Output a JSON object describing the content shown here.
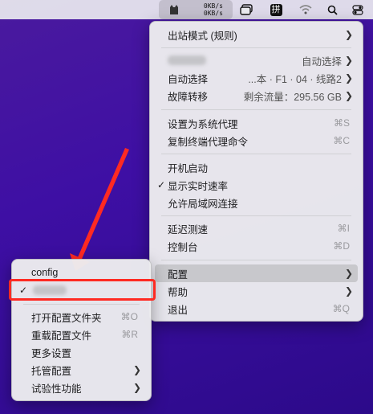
{
  "menubar": {
    "upload_speed": "0KB/s",
    "download_speed": "0KB/s",
    "input_method_label": "拼"
  },
  "main_menu": {
    "outbound_mode": "出站模式 (规则)",
    "proxy_group_1_value": "自动选择",
    "auto_select_label": "自动选择",
    "auto_select_value": "...本 · F1 · 04 · 线路2",
    "failover_label": "故障转移",
    "failover_value": "剩余流量：295.56 GB",
    "set_system_proxy": "设置为系统代理",
    "set_system_proxy_shortcut": "⌘S",
    "copy_terminal_cmd": "复制终端代理命令",
    "copy_terminal_cmd_shortcut": "⌘C",
    "launch_at_login": "开机启动",
    "show_realtime_speed": "显示实时速率",
    "allow_lan": "允许局域网连接",
    "latency_test": "延迟测速",
    "latency_test_shortcut": "⌘I",
    "console": "控制台",
    "console_shortcut": "⌘D",
    "config": "配置",
    "help": "帮助",
    "quit": "退出",
    "quit_shortcut": "⌘Q"
  },
  "config_submenu": {
    "config_item": "config",
    "open_config_folder": "打开配置文件夹",
    "open_config_folder_shortcut": "⌘O",
    "reload_config": "重载配置文件",
    "reload_config_shortcut": "⌘R",
    "more_settings": "更多设置",
    "managed_config": "托管配置",
    "experimental": "试验性功能"
  },
  "colors": {
    "wallpaper": "#3e0fa4",
    "annotation_red": "#ff2a22",
    "highlight": "#c8c8cc"
  }
}
